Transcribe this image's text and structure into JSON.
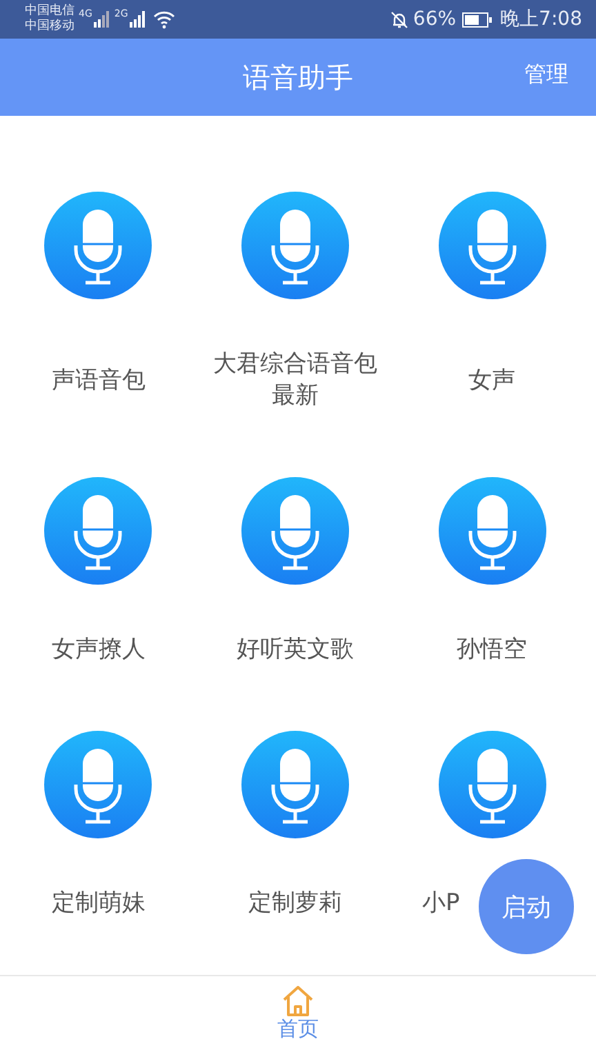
{
  "status_bar": {
    "carrier_1": "中国电信",
    "carrier_2": "中国移动",
    "network_1": "4G",
    "network_2": "2G",
    "battery": "66%",
    "time": "晚上7:08"
  },
  "header": {
    "title": "语音助手",
    "action": "管理"
  },
  "voice_packs": [
    {
      "label": "声语音包"
    },
    {
      "label": "大君综合语音包最新"
    },
    {
      "label": "女声"
    },
    {
      "label": "女声撩人"
    },
    {
      "label": "好听英文歌"
    },
    {
      "label": "孙悟空"
    },
    {
      "label": "定制萌妹"
    },
    {
      "label": "定制萝莉"
    },
    {
      "label": "小P"
    }
  ],
  "fab": {
    "label": "启动"
  },
  "bottom_nav": [
    {
      "label": "首页",
      "selected": true
    }
  ]
}
